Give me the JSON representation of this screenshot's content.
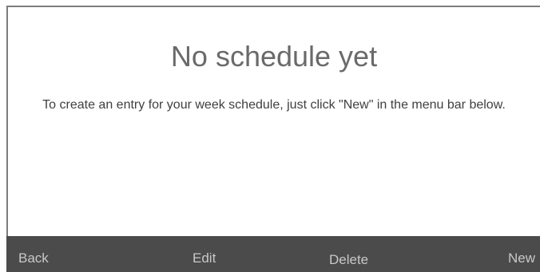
{
  "empty_state": {
    "title": "No schedule yet",
    "message": "To create an entry for your week schedule, just click \"New\" in the menu bar below."
  },
  "menu_bar": {
    "back_label": "Back",
    "edit_label": "Edit",
    "delete_label": "Delete",
    "new_label": "New"
  }
}
